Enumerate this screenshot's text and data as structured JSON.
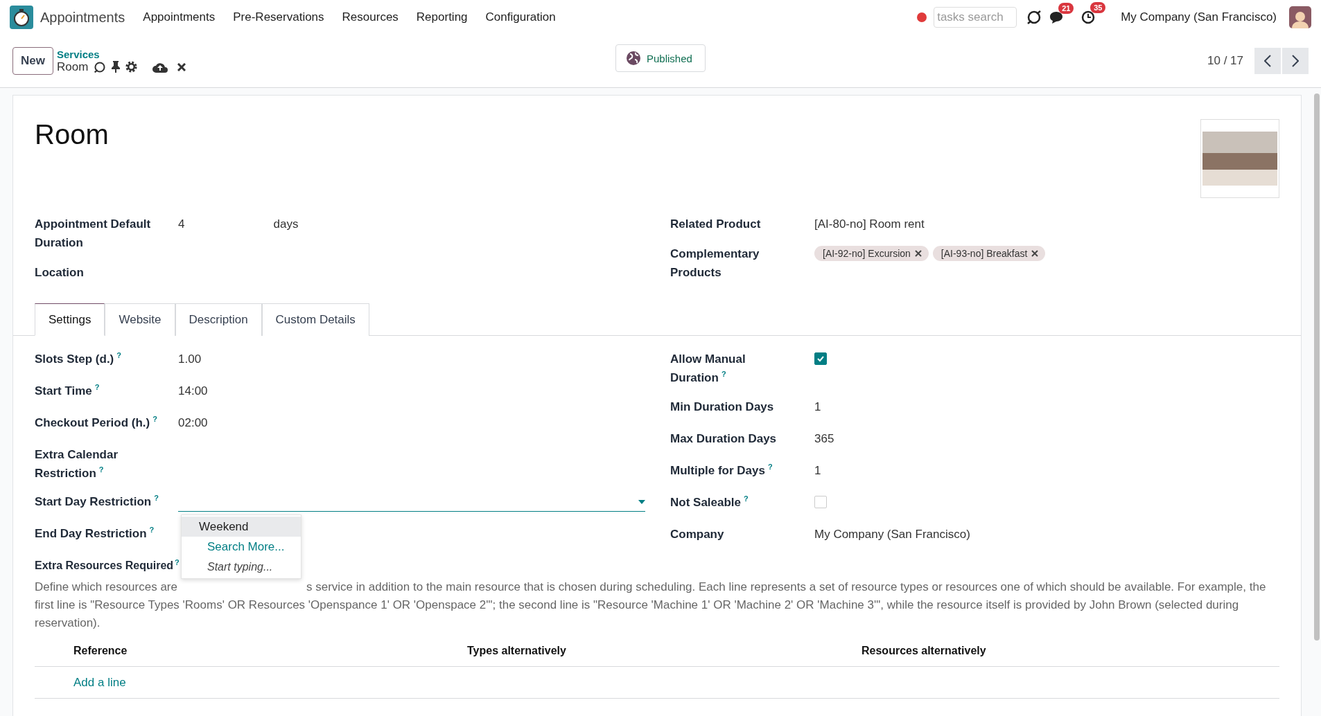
{
  "app": {
    "name": "Appointments"
  },
  "menu": [
    "Appointments",
    "Pre-Reservations",
    "Resources",
    "Reporting",
    "Configuration"
  ],
  "systray": {
    "search": {
      "placeholder": "tasks search"
    },
    "chat_badge": "21",
    "activity_badge": "35",
    "company": "My Company (San Francisco)"
  },
  "control_panel": {
    "new_button": "New",
    "breadcrumb": "Services",
    "record": "Room",
    "status_button": "Published",
    "pager": "10 / 17"
  },
  "form": {
    "title": "Room",
    "left_fields": [
      {
        "label": "Appointment Default Duration",
        "value": "4",
        "unit": "days"
      },
      {
        "label": "Location"
      }
    ],
    "right_fields": [
      {
        "label": "Related Product",
        "value": "[AI-80-no] Room rent"
      },
      {
        "label": "Complementary Products",
        "tags": [
          "[AI-92-no] Excursion",
          "[AI-93-no] Breakfast"
        ]
      }
    ],
    "tabs": [
      {
        "label": "Settings",
        "selected": true
      },
      {
        "label": "Website",
        "selected": false
      },
      {
        "label": "Description",
        "selected": false
      },
      {
        "label": "Custom Details",
        "selected": false
      }
    ],
    "settings_left": [
      {
        "label": "Slots Step (d.)",
        "help": "?",
        "kind": "text",
        "value": "1.00"
      },
      {
        "label": "Start Time",
        "help": "?",
        "kind": "text",
        "value": "14:00"
      },
      {
        "label": "Checkout Period (h.)",
        "help": "?",
        "kind": "text",
        "value": "02:00"
      },
      {
        "label": "Extra Calendar Restriction",
        "help": "?",
        "kind": "text"
      },
      {
        "label": "Start Day Restriction",
        "help": "?",
        "kind": "select"
      },
      {
        "label": "End Day Restriction",
        "help": "?",
        "kind": "text"
      }
    ],
    "settings_right": [
      {
        "label": "Allow Manual Duration",
        "help": "?",
        "kind": "checkbox",
        "checked": true
      },
      {
        "label": "Min Duration Days",
        "kind": "text",
        "value": "1"
      },
      {
        "label": "Max Duration Days",
        "kind": "text",
        "value": "365"
      },
      {
        "label": "Multiple for Days",
        "help": "?",
        "kind": "text",
        "value": "1"
      },
      {
        "label": "Not Saleable",
        "help": "?",
        "kind": "checkbox",
        "checked": false
      },
      {
        "label": "Company",
        "kind": "text",
        "value": "My Company (San Francisco)"
      }
    ],
    "dropdown": [
      {
        "kind": "option",
        "label": "Weekend"
      },
      {
        "kind": "link",
        "label": "Search More..."
      },
      {
        "kind": "hint",
        "label": "Start typing..."
      }
    ],
    "extra_resources": {
      "label": "Extra Resources Required",
      "help": "?",
      "description_parts": [
        "Define which resources are",
        "s service in addition to the main resource that is chosen during scheduling. Each line represents a set of resource types or resources one of which should be available. For example, the first line is \"Resource Types 'Rooms' OR Resources 'Openspance 1' OR 'Openspace 2'\"; the second line is \"Resource 'Machine 1' OR 'Machine 2' OR 'Machine 3'\", while the resource itself is provided by John Brown (selected during reservation)."
      ],
      "columns": [
        "Reference",
        "Types alternatively",
        "Resources alternatively"
      ],
      "add_line": "Add a line"
    }
  }
}
